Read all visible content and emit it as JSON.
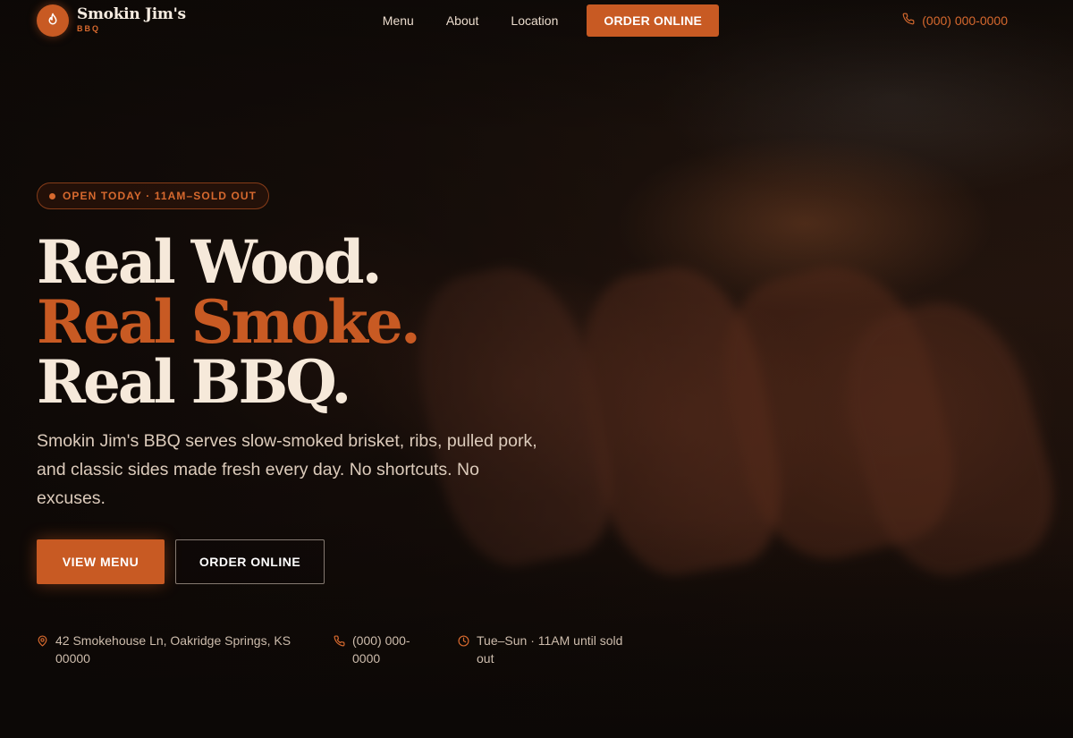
{
  "header": {
    "brand_name": "Smokin Jim's",
    "brand_sub": "BBQ",
    "nav": [
      "Menu",
      "About",
      "Location"
    ],
    "cta": "ORDER ONLINE",
    "phone": "(000) 000-0000"
  },
  "hero": {
    "badge": "OPEN TODAY · 11AM–SOLD OUT",
    "headline": [
      "Real Wood.",
      "Real Smoke.",
      "Real BBQ."
    ],
    "lede": "Smokin Jim's BBQ serves slow-smoked brisket, ribs, pulled pork, and classic sides made fresh every day. No shortcuts. No excuses.",
    "primary_button": "VIEW MENU",
    "secondary_button": "ORDER ONLINE"
  },
  "info": {
    "address": "42 Smokehouse Ln, Oakridge Springs, KS 00000",
    "phone": "(000) 000-0000",
    "hours": "Tue–Sun · 11AM until sold out"
  },
  "icons": {
    "brand": "flame-icon",
    "phone": "phone-icon",
    "location": "map-pin-icon",
    "hours": "clock-icon"
  },
  "colors": {
    "accent": "#c85a23",
    "text_light": "#f6e9da",
    "background": "#120c09"
  }
}
